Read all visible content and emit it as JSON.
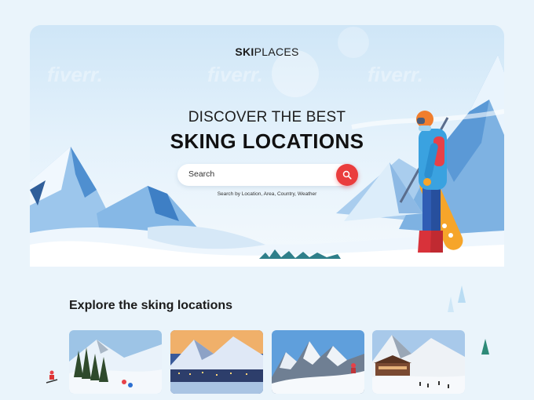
{
  "brand": {
    "bold": "SKI",
    "rest": "PLACES"
  },
  "hero": {
    "headline_line1": "DISCOVER THE BEST",
    "headline_line2": "SKING LOCATIONS",
    "watermark": "fiverr."
  },
  "search": {
    "placeholder": "Search",
    "hint": "Search by Location, Area, Country, Weather",
    "button_icon": "search-icon"
  },
  "explore": {
    "title": "Explore the sking locations",
    "cards": [
      {
        "name": "location-card-1",
        "scene": "forest-slope-with-skiers"
      },
      {
        "name": "location-card-2",
        "scene": "alpine-village-at-dusk"
      },
      {
        "name": "location-card-3",
        "scene": "rocky-peaks-with-skier"
      },
      {
        "name": "location-card-4",
        "scene": "ski-resort-chalets"
      }
    ]
  },
  "colors": {
    "accent": "#ea3d3d",
    "sky": "#cfe6f7",
    "mountain": "#6fa9dc"
  }
}
